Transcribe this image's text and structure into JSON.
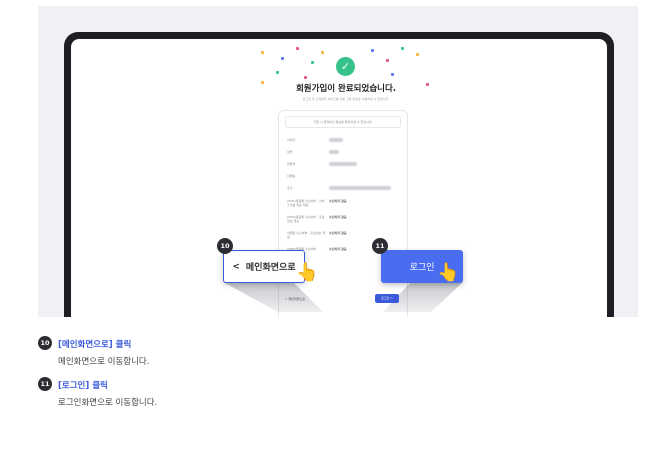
{
  "screen": {
    "title": "회원가입이 완료되었습니다.",
    "subtitle": "로그인 후 고객센터 서비스를 이용 고유 번호로 이용하실 수 있습니다.",
    "notice": "가입 시 입력하신 정보를 확인하실 수 있습니다.",
    "fields": [
      {
        "label": "아이디"
      },
      {
        "label": "성명"
      },
      {
        "label": "연락처"
      },
      {
        "label": "이메일"
      },
      {
        "label": "주소"
      },
      {
        "label": "(SMS)알림톡 수신여부 - 서비스이용 정보 제공",
        "value": "수신하지 않음"
      },
      {
        "label": "(SMS)알림톡 수신여부 - 홍보정보 제공",
        "value": "수신하지 않음"
      },
      {
        "label": "이메일 수신여부 - 홍보정보 제공",
        "value": "수신하지 않음"
      },
      {
        "label": "(SMS)알림톡 수신여부",
        "value": "수신하지 않음"
      }
    ],
    "mini_main_button": "< 메인화면으로",
    "mini_login_button": "로그인 >"
  },
  "callouts": {
    "main_button": {
      "badge": "10",
      "label": "메인화면으로",
      "chevron": "<"
    },
    "login_button": {
      "badge": "11",
      "label": "로그인"
    }
  },
  "steps": [
    {
      "num": "10",
      "title": "[메인화면으로] 클릭",
      "desc": "메인화면으로 이동합니다."
    },
    {
      "num": "11",
      "title": "[로그인] 클릭",
      "desc": "로그인화면으로 이동합니다."
    }
  ],
  "colors": {
    "accent": "#3b5bdb",
    "success": "#36c28a",
    "badge": "#2b2d33"
  },
  "icons": {
    "check": "check-icon",
    "hand": "pointer-hand-icon"
  }
}
